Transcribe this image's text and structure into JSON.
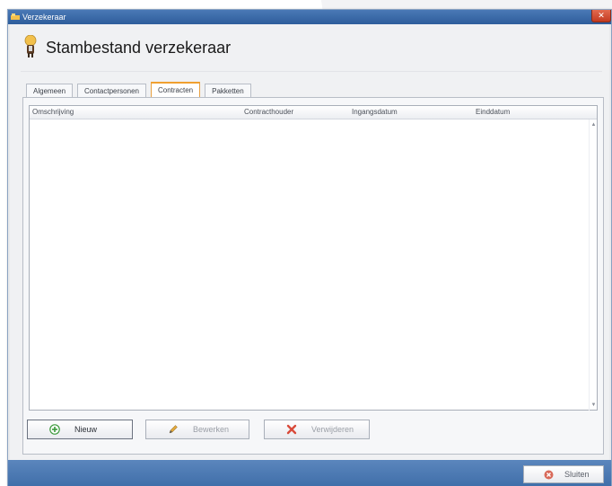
{
  "window": {
    "title": "Verzekeraar",
    "close_glyph": "✕"
  },
  "header": {
    "title": "Stambestand verzekeraar",
    "icon": "person-icon"
  },
  "tabs": [
    {
      "label": "Algemeen",
      "active": false
    },
    {
      "label": "Contactpersonen",
      "active": false
    },
    {
      "label": "Contracten",
      "active": true
    },
    {
      "label": "Pakketten",
      "active": false
    }
  ],
  "grid": {
    "columns": [
      "Omschrijving",
      "Contracthouder",
      "Ingangsdatum",
      "Einddatum"
    ],
    "rows": [],
    "scroll_up": "▲",
    "scroll_down": "▼"
  },
  "buttons": {
    "new": {
      "label": "Nieuw",
      "icon": "add-icon",
      "enabled": true
    },
    "edit": {
      "label": "Bewerken",
      "icon": "pencil-icon",
      "enabled": false
    },
    "delete": {
      "label": "Verwijderen",
      "icon": "delete-icon",
      "enabled": false
    }
  },
  "footer": {
    "close_label": "Sluiten",
    "close_icon": "close-icon"
  },
  "colors": {
    "accent_tab": "#f0a030",
    "titlebar": "#3e6ca8",
    "footer": "#4a79b3"
  }
}
